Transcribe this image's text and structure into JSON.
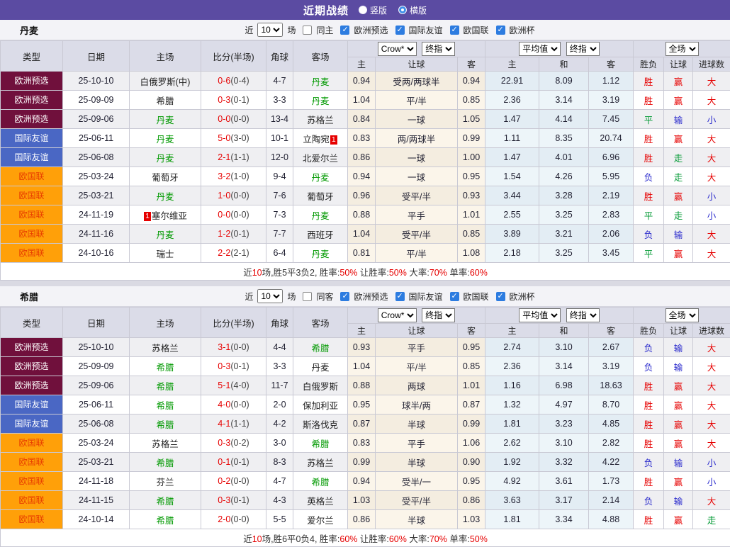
{
  "title_bar": {
    "title": "近期战绩",
    "radio_vertical": "竖版",
    "radio_horizontal": "横版",
    "selected": "横版"
  },
  "filter_labels": {
    "near": "近",
    "games": "场",
    "leagues": [
      "欧洲预选",
      "国际友谊",
      "欧国联",
      "欧洲杯"
    ],
    "leagues_checked": [
      true,
      true,
      true,
      true
    ]
  },
  "table_header": {
    "col_type": "类型",
    "col_date": "日期",
    "col_home": "主场",
    "col_score": "比分(半场)",
    "col_corner": "角球",
    "col_away": "客场",
    "bookmaker_select": "Crow*",
    "final_select": "终指",
    "avg_select": "平均值",
    "final_select2": "终指",
    "fulltime_select": "全场",
    "sub_home": "主",
    "sub_handicap": "让球",
    "sub_away": "客",
    "sub_avg_home": "主",
    "sub_avg_draw": "和",
    "sub_avg_away": "客",
    "sub_wdl": "胜负",
    "sub_handicap_result": "让球",
    "sub_goals": "进球数"
  },
  "type_styles": {
    "欧洲预选": {
      "bg": "#70103c",
      "fg": "#ffffff"
    },
    "国际友谊": {
      "bg": "#4a67c4",
      "fg": "#ffffff"
    },
    "欧国联": {
      "bg": "#ffa009",
      "fg": "#e83c00"
    }
  },
  "result_colors": {
    "胜": "#e60000",
    "平": "#009933",
    "负": "#2828cc",
    "赢": "#e60000",
    "输": "#2828cc",
    "走": "#009933",
    "大": "#e60000",
    "小": "#2828cc"
  },
  "accent_colors": {
    "titlebar_purple": "#5b4ba2",
    "checkbox_blue": "#2d7ce0",
    "focus_team_green": "#009900",
    "score_red": "#e60000"
  },
  "sections": [
    {
      "team": "丹麦",
      "filter": {
        "count": "10",
        "same": "同主",
        "same_checked": false
      },
      "rows": [
        {
          "type": "欧洲预选",
          "date": "25-10-10",
          "home": "白俄罗斯(中)",
          "home_badge": "",
          "score": "0-6",
          "half": "(0-4)",
          "corners": "4-7",
          "away": "丹麦",
          "away_badge": "",
          "odds_home": "0.94",
          "handicap": "受两/两球半",
          "odds_away": "0.94",
          "avg_home": "22.91",
          "avg_draw": "8.09",
          "avg_away": "1.12",
          "r1": "胜",
          "r2": "赢",
          "r3": "大"
        },
        {
          "type": "欧洲预选",
          "date": "25-09-09",
          "home": "希腊",
          "home_badge": "",
          "score": "0-3",
          "half": "(0-1)",
          "corners": "3-3",
          "away": "丹麦",
          "away_badge": "",
          "odds_home": "1.04",
          "handicap": "平/半",
          "odds_away": "0.85",
          "avg_home": "2.36",
          "avg_draw": "3.14",
          "avg_away": "3.19",
          "r1": "胜",
          "r2": "赢",
          "r3": "大"
        },
        {
          "type": "欧洲预选",
          "date": "25-09-06",
          "home": "丹麦",
          "home_badge": "",
          "score": "0-0",
          "half": "(0-0)",
          "corners": "13-4",
          "away": "苏格兰",
          "away_badge": "",
          "odds_home": "0.84",
          "handicap": "一球",
          "odds_away": "1.05",
          "avg_home": "1.47",
          "avg_draw": "4.14",
          "avg_away": "7.45",
          "r1": "平",
          "r2": "输",
          "r3": "小"
        },
        {
          "type": "国际友谊",
          "date": "25-06-11",
          "home": "丹麦",
          "home_badge": "",
          "score": "5-0",
          "half": "(3-0)",
          "corners": "10-1",
          "away": "立陶宛",
          "away_badge": "1",
          "odds_home": "0.83",
          "handicap": "两/两球半",
          "odds_away": "0.99",
          "avg_home": "1.11",
          "avg_draw": "8.35",
          "avg_away": "20.74",
          "r1": "胜",
          "r2": "赢",
          "r3": "大"
        },
        {
          "type": "国际友谊",
          "date": "25-06-08",
          "home": "丹麦",
          "home_badge": "",
          "score": "2-1",
          "half": "(1-1)",
          "corners": "12-0",
          "away": "北爱尔兰",
          "away_badge": "",
          "odds_home": "0.86",
          "handicap": "一球",
          "odds_away": "1.00",
          "avg_home": "1.47",
          "avg_draw": "4.01",
          "avg_away": "6.96",
          "r1": "胜",
          "r2": "走",
          "r3": "大"
        },
        {
          "type": "欧国联",
          "date": "25-03-24",
          "home": "葡萄牙",
          "home_badge": "",
          "score": "3-2",
          "half": "(1-0)",
          "corners": "9-4",
          "away": "丹麦",
          "away_badge": "",
          "odds_home": "0.94",
          "handicap": "一球",
          "odds_away": "0.95",
          "avg_home": "1.54",
          "avg_draw": "4.26",
          "avg_away": "5.95",
          "r1": "负",
          "r2": "走",
          "r3": "大"
        },
        {
          "type": "欧国联",
          "date": "25-03-21",
          "home": "丹麦",
          "home_badge": "",
          "score": "1-0",
          "half": "(0-0)",
          "corners": "7-6",
          "away": "葡萄牙",
          "away_badge": "",
          "odds_home": "0.96",
          "handicap": "受平/半",
          "odds_away": "0.93",
          "avg_home": "3.44",
          "avg_draw": "3.28",
          "avg_away": "2.19",
          "r1": "胜",
          "r2": "赢",
          "r3": "小"
        },
        {
          "type": "欧国联",
          "date": "24-11-19",
          "home": "塞尔维亚",
          "home_badge": "1",
          "score": "0-0",
          "half": "(0-0)",
          "corners": "7-3",
          "away": "丹麦",
          "away_badge": "",
          "odds_home": "0.88",
          "handicap": "平手",
          "odds_away": "1.01",
          "avg_home": "2.55",
          "avg_draw": "3.25",
          "avg_away": "2.83",
          "r1": "平",
          "r2": "走",
          "r3": "小"
        },
        {
          "type": "欧国联",
          "date": "24-11-16",
          "home": "丹麦",
          "home_badge": "",
          "score": "1-2",
          "half": "(0-1)",
          "corners": "7-7",
          "away": "西班牙",
          "away_badge": "",
          "odds_home": "1.04",
          "handicap": "受平/半",
          "odds_away": "0.85",
          "avg_home": "3.89",
          "avg_draw": "3.21",
          "avg_away": "2.06",
          "r1": "负",
          "r2": "输",
          "r3": "大"
        },
        {
          "type": "欧国联",
          "date": "24-10-16",
          "home": "瑞士",
          "home_badge": "",
          "score": "2-2",
          "half": "(2-1)",
          "corners": "6-4",
          "away": "丹麦",
          "away_badge": "",
          "odds_home": "0.81",
          "handicap": "平/半",
          "odds_away": "1.08",
          "avg_home": "2.18",
          "avg_draw": "3.25",
          "avg_away": "3.45",
          "r1": "平",
          "r2": "赢",
          "r3": "大"
        }
      ],
      "summary": {
        "pre": "近",
        "n": "10",
        "mid": "场,胜5平3负2, 胜率:",
        "v1": "50%",
        "m2": " 让胜率:",
        "v2": "50%",
        "m3": " 大率:",
        "v3": "70%",
        "m4": " 单率:",
        "v4": "60%"
      }
    },
    {
      "team": "希腊",
      "filter": {
        "count": "10",
        "same": "同客",
        "same_checked": false
      },
      "rows": [
        {
          "type": "欧洲预选",
          "date": "25-10-10",
          "home": "苏格兰",
          "home_badge": "",
          "score": "3-1",
          "half": "(0-0)",
          "corners": "4-4",
          "away": "希腊",
          "away_badge": "",
          "odds_home": "0.93",
          "handicap": "平手",
          "odds_away": "0.95",
          "avg_home": "2.74",
          "avg_draw": "3.10",
          "avg_away": "2.67",
          "r1": "负",
          "r2": "输",
          "r3": "大"
        },
        {
          "type": "欧洲预选",
          "date": "25-09-09",
          "home": "希腊",
          "home_badge": "",
          "score": "0-3",
          "half": "(0-1)",
          "corners": "3-3",
          "away": "丹麦",
          "away_badge": "",
          "odds_home": "1.04",
          "handicap": "平/半",
          "odds_away": "0.85",
          "avg_home": "2.36",
          "avg_draw": "3.14",
          "avg_away": "3.19",
          "r1": "负",
          "r2": "输",
          "r3": "大"
        },
        {
          "type": "欧洲预选",
          "date": "25-09-06",
          "home": "希腊",
          "home_badge": "",
          "score": "5-1",
          "half": "(4-0)",
          "corners": "11-7",
          "away": "白俄罗斯",
          "away_badge": "",
          "odds_home": "0.88",
          "handicap": "两球",
          "odds_away": "1.01",
          "avg_home": "1.16",
          "avg_draw": "6.98",
          "avg_away": "18.63",
          "r1": "胜",
          "r2": "赢",
          "r3": "大"
        },
        {
          "type": "国际友谊",
          "date": "25-06-11",
          "home": "希腊",
          "home_badge": "",
          "score": "4-0",
          "half": "(0-0)",
          "corners": "2-0",
          "away": "保加利亚",
          "away_badge": "",
          "odds_home": "0.95",
          "handicap": "球半/两",
          "odds_away": "0.87",
          "avg_home": "1.32",
          "avg_draw": "4.97",
          "avg_away": "8.70",
          "r1": "胜",
          "r2": "赢",
          "r3": "大"
        },
        {
          "type": "国际友谊",
          "date": "25-06-08",
          "home": "希腊",
          "home_badge": "",
          "score": "4-1",
          "half": "(1-1)",
          "corners": "4-2",
          "away": "斯洛伐克",
          "away_badge": "",
          "odds_home": "0.87",
          "handicap": "半球",
          "odds_away": "0.99",
          "avg_home": "1.81",
          "avg_draw": "3.23",
          "avg_away": "4.85",
          "r1": "胜",
          "r2": "赢",
          "r3": "大"
        },
        {
          "type": "欧国联",
          "date": "25-03-24",
          "home": "苏格兰",
          "home_badge": "",
          "score": "0-3",
          "half": "(0-2)",
          "corners": "3-0",
          "away": "希腊",
          "away_badge": "",
          "odds_home": "0.83",
          "handicap": "平手",
          "odds_away": "1.06",
          "avg_home": "2.62",
          "avg_draw": "3.10",
          "avg_away": "2.82",
          "r1": "胜",
          "r2": "赢",
          "r3": "大"
        },
        {
          "type": "欧国联",
          "date": "25-03-21",
          "home": "希腊",
          "home_badge": "",
          "score": "0-1",
          "half": "(0-1)",
          "corners": "8-3",
          "away": "苏格兰",
          "away_badge": "",
          "odds_home": "0.99",
          "handicap": "半球",
          "odds_away": "0.90",
          "avg_home": "1.92",
          "avg_draw": "3.32",
          "avg_away": "4.22",
          "r1": "负",
          "r2": "输",
          "r3": "小"
        },
        {
          "type": "欧国联",
          "date": "24-11-18",
          "home": "芬兰",
          "home_badge": "",
          "score": "0-2",
          "half": "(0-0)",
          "corners": "4-7",
          "away": "希腊",
          "away_badge": "",
          "odds_home": "0.94",
          "handicap": "受半/一",
          "odds_away": "0.95",
          "avg_home": "4.92",
          "avg_draw": "3.61",
          "avg_away": "1.73",
          "r1": "胜",
          "r2": "赢",
          "r3": "小"
        },
        {
          "type": "欧国联",
          "date": "24-11-15",
          "home": "希腊",
          "home_badge": "",
          "score": "0-3",
          "half": "(0-1)",
          "corners": "4-3",
          "away": "英格兰",
          "away_badge": "",
          "odds_home": "1.03",
          "handicap": "受平/半",
          "odds_away": "0.86",
          "avg_home": "3.63",
          "avg_draw": "3.17",
          "avg_away": "2.14",
          "r1": "负",
          "r2": "输",
          "r3": "大"
        },
        {
          "type": "欧国联",
          "date": "24-10-14",
          "home": "希腊",
          "home_badge": "",
          "score": "2-0",
          "half": "(0-0)",
          "corners": "5-5",
          "away": "爱尔兰",
          "away_badge": "",
          "odds_home": "0.86",
          "handicap": "半球",
          "odds_away": "1.03",
          "avg_home": "1.81",
          "avg_draw": "3.34",
          "avg_away": "4.88",
          "r1": "胜",
          "r2": "赢",
          "r3": "走"
        }
      ],
      "summary": {
        "pre": "近",
        "n": "10",
        "mid": "场,胜6平0负4, 胜率:",
        "v1": "60%",
        "m2": " 让胜率:",
        "v2": "60%",
        "m3": " 大率:",
        "v3": "70%",
        "m4": " 单率:",
        "v4": "50%"
      }
    }
  ]
}
